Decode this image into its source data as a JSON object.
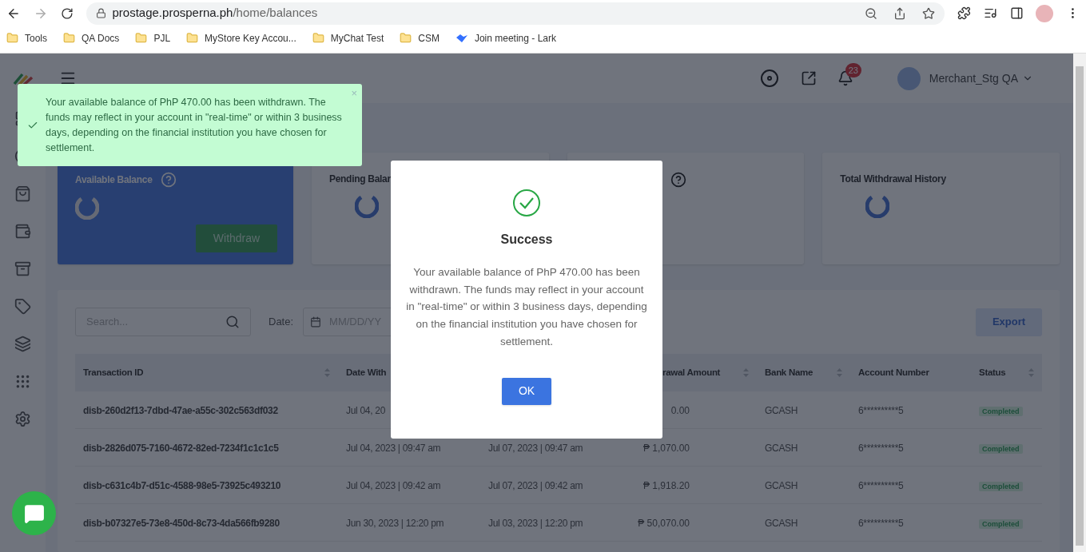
{
  "browser": {
    "url_host": "prostage.prosperna.ph",
    "url_path": "/home/balances",
    "bookmarks": [
      {
        "label": "Tools",
        "kind": "folder"
      },
      {
        "label": "QA Docs",
        "kind": "folder"
      },
      {
        "label": "PJL",
        "kind": "folder"
      },
      {
        "label": "MyStore Key Accou...",
        "kind": "folder"
      },
      {
        "label": "MyChat Test",
        "kind": "folder"
      },
      {
        "label": "CSM",
        "kind": "folder"
      },
      {
        "label": "Join meeting - Lark",
        "kind": "link"
      }
    ]
  },
  "header": {
    "notifications": "23",
    "user": "Merchant_Stg QA"
  },
  "toast": {
    "message": "Your available balance of PhP 470.00 has been withdrawn. The funds may reflect in your account in \"real-time\" or within 3 business days, depending on the financial institution you have chosen for settlement.",
    "close": "×"
  },
  "cards": [
    {
      "title": "Available Balance",
      "kind": "primary",
      "help": true,
      "loading": true,
      "button": "Withdraw"
    },
    {
      "title": "Pending Balar",
      "kind": "plain",
      "help": false,
      "loading": true
    },
    {
      "kind": "plain",
      "help": true,
      "loading": false
    },
    {
      "title": "Total Withdrawal History",
      "kind": "plain",
      "help": false,
      "loading": true
    }
  ],
  "filters": {
    "search_placeholder": "Search...",
    "date_label": "Date:",
    "date_placeholder": "MM/DD/YY",
    "export": "Export"
  },
  "table": {
    "columns": [
      {
        "label": "Transaction ID",
        "sort": true
      },
      {
        "label": "Date With",
        "sort": false
      },
      {
        "sort": false
      },
      {
        "label": "rawal Amount",
        "sort": true
      },
      {
        "label": "Bank Name",
        "sort": true
      },
      {
        "label": "Account Number",
        "sort": false
      },
      {
        "label": "Status",
        "sort": true
      }
    ],
    "rows": [
      {
        "transaction_id": "disb-260d2f13-7dbd-47ae-a55c-302c563df032",
        "date_withdrawn": "Jul 04, 20",
        "amount": "0.00",
        "bank_name": "GCASH",
        "account_number": "6**********5",
        "status": "Completed"
      },
      {
        "transaction_id": "disb-2826d075-7160-4672-82ed-7234f1c1c1c5",
        "date_withdrawn": "Jul 04, 2023 | 09:47 am",
        "column_3": "Jul 07, 2023 | 09:47 am",
        "amount": "₱ 1,070.00",
        "bank_name": "GCASH",
        "account_number": "6**********5",
        "status": "Completed"
      },
      {
        "transaction_id": "disb-c631c4b7-d51c-4588-98e5-73925c493210",
        "date_withdrawn": "Jul 04, 2023 | 09:42 am",
        "column_3": "Jul 07, 2023 | 09:42 am",
        "amount": "₱ 1,918.20",
        "bank_name": "GCASH",
        "account_number": "6**********5",
        "status": "Completed"
      },
      {
        "transaction_id": "disb-b07327e5-73e8-450d-8c73-4da566fb9280",
        "date_withdrawn": "Jun 30, 2023 | 12:20 pm",
        "column_3": "Jul 03, 2023 | 12:20 pm",
        "amount": "₱ 50,070.00",
        "bank_name": "GCASH",
        "account_number": "6**********5",
        "status": "Completed"
      }
    ]
  },
  "modal": {
    "title": "Success",
    "message": "Your available balance of PhP 470.00 has been withdrawn. The funds may reflect in your account in \"real-time\" or within 3 business days, depending on the financial institution you have chosen for settlement.",
    "button": "OK"
  }
}
